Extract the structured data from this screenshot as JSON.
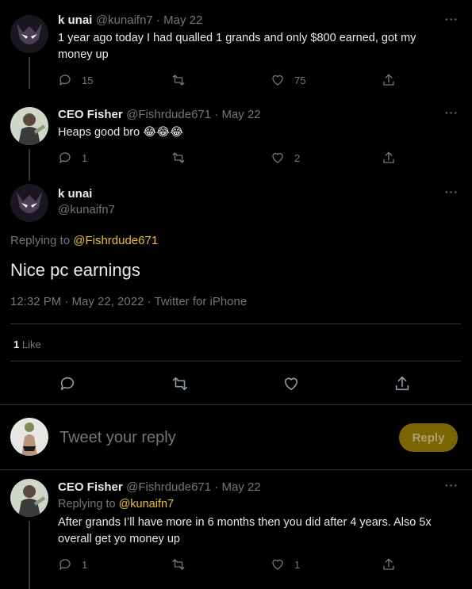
{
  "tweet1": {
    "name": "k unai",
    "handle": "@kunaifn7",
    "date": "May 22",
    "text": "1 year ago today I had qualled 1 grands and only $800 earned, got my money up",
    "replies": "15",
    "retweets": "",
    "likes": "75"
  },
  "tweet2": {
    "name": "CEO Fisher",
    "handle": "@Fishrdude671",
    "date": "May 22",
    "text": "Heaps good bro 😂😂😂",
    "replies": "1",
    "retweets": "",
    "likes": "2"
  },
  "main_tweet": {
    "name": "k unai",
    "handle": "@kunaifn7",
    "replying_to_label": "Replying to",
    "replying_to_handle": "@Fishrdude671",
    "text": "Nice pc earnings",
    "timestamp": "12:32 PM · May 22, 2022 · Twitter for iPhone",
    "like_count": "1",
    "like_label": "Like"
  },
  "composer": {
    "placeholder": "Tweet your reply",
    "button_label": "Reply"
  },
  "tweet3": {
    "name": "CEO Fisher",
    "handle": "@Fishrdude671",
    "date": "May 22",
    "replying_to_label": "Replying to",
    "replying_to_handle": "@kunaifn7",
    "text": "After grands I’ll have more in 6 months then you did after 4 years. Also 5x overall get yo money up",
    "replies": "1",
    "retweets": "",
    "likes": "1"
  },
  "more_glyph": "···",
  "separator": " · ",
  "colors": {
    "accent": "#e8c021",
    "background": "#000000",
    "muted": "#71767b"
  }
}
